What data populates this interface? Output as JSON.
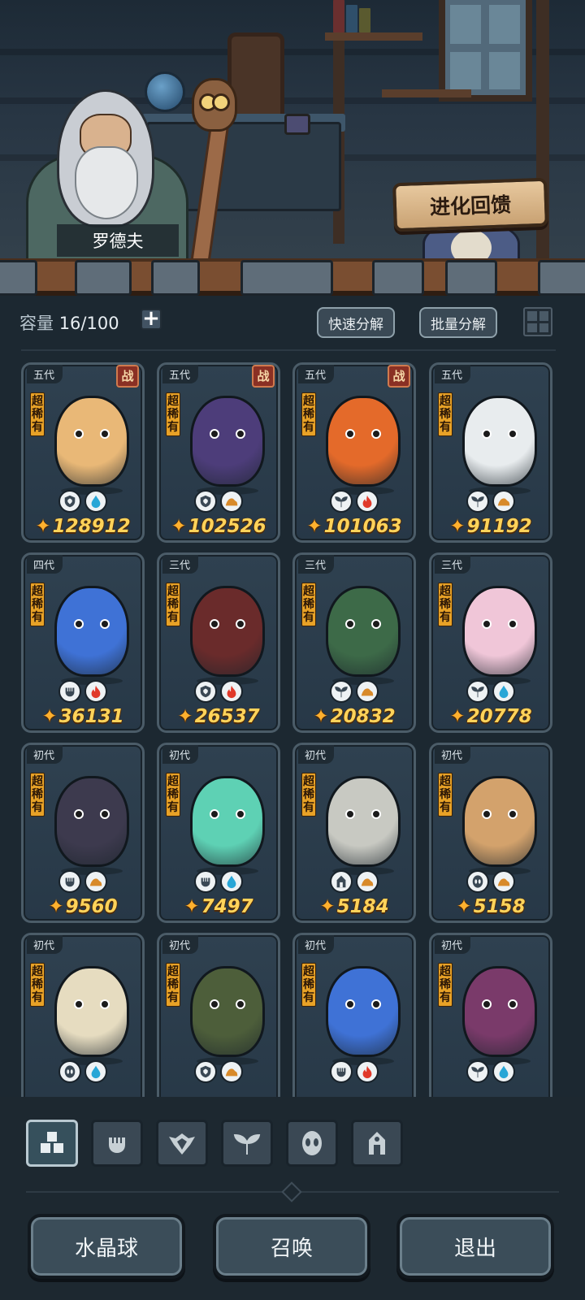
{
  "scene": {
    "npc_name": "罗德夫",
    "evolution_sign": "进化回馈"
  },
  "capacity": {
    "label": "容量",
    "value": "16/100",
    "add_symbol": "+",
    "quick_decompose": "快速分解",
    "batch_decompose": "批量分解"
  },
  "cards": [
    {
      "gen": "五代",
      "rarity": "超稀有",
      "battle": "战",
      "power": "128912",
      "icons": [
        "shield-icon",
        "water-icon"
      ],
      "color": "#e9b877"
    },
    {
      "gen": "五代",
      "rarity": "超稀有",
      "battle": "战",
      "power": "102526",
      "icons": [
        "shield-icon",
        "earth-icon"
      ],
      "color": "#4d3d7a"
    },
    {
      "gen": "五代",
      "rarity": "超稀有",
      "battle": "战",
      "power": "101063",
      "icons": [
        "leaf-icon",
        "fire-icon"
      ],
      "color": "#e46a2a"
    },
    {
      "gen": "五代",
      "rarity": "超稀有",
      "battle": "",
      "power": "91192",
      "icons": [
        "leaf-icon",
        "earth-icon"
      ],
      "color": "#e8ecee"
    },
    {
      "gen": "四代",
      "rarity": "超稀有",
      "battle": "",
      "power": "36131",
      "icons": [
        "fist-icon",
        "fire-icon"
      ],
      "color": "#3f72d6"
    },
    {
      "gen": "三代",
      "rarity": "超稀有",
      "battle": "",
      "power": "26537",
      "icons": [
        "shield-icon",
        "fire-icon"
      ],
      "color": "#6a2b2b"
    },
    {
      "gen": "三代",
      "rarity": "超稀有",
      "battle": "",
      "power": "20832",
      "icons": [
        "leaf-icon",
        "earth-icon"
      ],
      "color": "#3d6a48"
    },
    {
      "gen": "三代",
      "rarity": "超稀有",
      "battle": "",
      "power": "20778",
      "icons": [
        "leaf-icon",
        "water-icon"
      ],
      "color": "#f0c6d8"
    },
    {
      "gen": "初代",
      "rarity": "超稀有",
      "battle": "",
      "power": "9560",
      "icons": [
        "fist-icon",
        "earth-icon"
      ],
      "color": "#3d3a4e"
    },
    {
      "gen": "初代",
      "rarity": "超稀有",
      "battle": "",
      "power": "7497",
      "icons": [
        "fist-icon",
        "water-icon"
      ],
      "color": "#5ed1b4"
    },
    {
      "gen": "初代",
      "rarity": "超稀有",
      "battle": "",
      "power": "5184",
      "icons": [
        "tower-icon",
        "earth-icon"
      ],
      "color": "#c8c9c2"
    },
    {
      "gen": "初代",
      "rarity": "超稀有",
      "battle": "",
      "power": "5158",
      "icons": [
        "eye-icon",
        "earth-icon"
      ],
      "color": "#d3a26c"
    },
    {
      "gen": "初代",
      "rarity": "超稀有",
      "battle": "",
      "power": "",
      "icons": [
        "eye-icon",
        "water-icon"
      ],
      "color": "#e6dcc0"
    },
    {
      "gen": "初代",
      "rarity": "超稀有",
      "battle": "",
      "power": "",
      "icons": [
        "shield-icon",
        "earth-icon"
      ],
      "color": "#4d5e3a"
    },
    {
      "gen": "初代",
      "rarity": "超稀有",
      "battle": "",
      "power": "",
      "icons": [
        "fist-icon",
        "fire-icon"
      ],
      "color": "#3f72d6"
    },
    {
      "gen": "初代",
      "rarity": "超稀有",
      "battle": "",
      "power": "",
      "icons": [
        "leaf-icon",
        "water-icon"
      ],
      "color": "#7a3a6a"
    }
  ],
  "filters": [
    "all-filter",
    "fist-filter",
    "shield-filter",
    "leaf-filter",
    "eye-filter",
    "tower-filter"
  ],
  "buttons": {
    "crystal_ball": "水晶球",
    "summon": "召唤",
    "exit": "退出"
  },
  "colors": {
    "power_text": "#ffd35a",
    "rarity_badge": "#e8a227",
    "battle_badge": "#8a3024"
  }
}
